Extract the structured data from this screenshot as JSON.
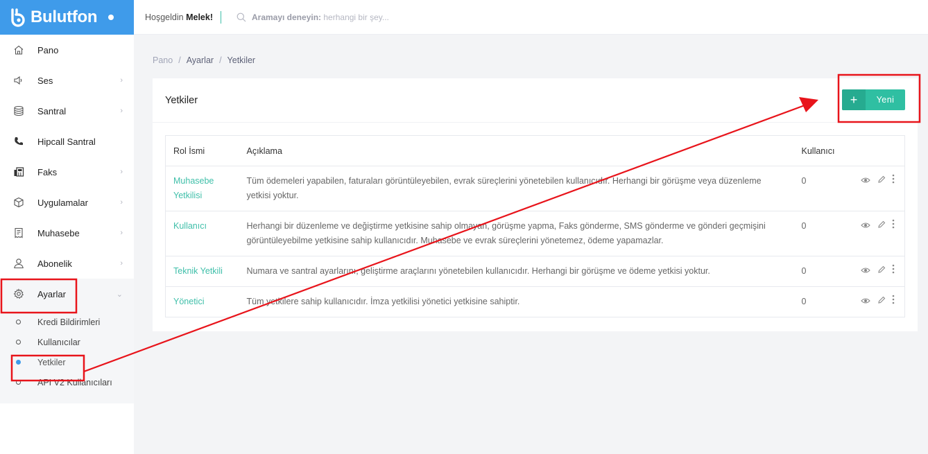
{
  "app": {
    "logo_text": "Bulutfon"
  },
  "header": {
    "greeting_prefix": "Hoşgeldin",
    "user_name": "Melek!",
    "search_label": "Aramayı deneyin:",
    "search_placeholder": "herhangi bir şey..."
  },
  "sidebar": {
    "items": [
      {
        "label": "Pano",
        "icon": "home-icon",
        "chevron": false
      },
      {
        "label": "Ses",
        "icon": "speaker-icon",
        "chevron": true
      },
      {
        "label": "Santral",
        "icon": "database-icon",
        "chevron": true
      },
      {
        "label": "Hipcall Santral",
        "icon": "phone-icon",
        "chevron": false
      },
      {
        "label": "Faks",
        "icon": "fax-icon",
        "chevron": true
      },
      {
        "label": "Uygulamalar",
        "icon": "box-icon",
        "chevron": true
      },
      {
        "label": "Muhasebe",
        "icon": "receipt-icon",
        "chevron": true
      },
      {
        "label": "Abonelik",
        "icon": "user-icon",
        "chevron": true
      },
      {
        "label": "Ayarlar",
        "icon": "gear-icon",
        "chevron": true,
        "expanded": true
      }
    ],
    "submenu": [
      {
        "label": "Kredi Bildirimleri",
        "active": false
      },
      {
        "label": "Kullanıcılar",
        "active": false
      },
      {
        "label": "Yetkiler",
        "active": true
      },
      {
        "label": "API V2 Kullanıcıları",
        "active": false
      }
    ]
  },
  "breadcrumb": [
    "Pano",
    "Ayarlar",
    "Yetkiler"
  ],
  "card": {
    "title": "Yetkiler",
    "new_button": "Yeni"
  },
  "table": {
    "headers": [
      "Rol İsmi",
      "Açıklama",
      "Kullanıcı"
    ],
    "rows": [
      {
        "role": "Muhasebe Yetkilisi",
        "description": "Tüm ödemeleri yapabilen, faturaları görüntüleyebilen, evrak süreçlerini yönetebilen kullanıcıdır. Herhangi bir görüşme veya düzenleme yetkisi yoktur.",
        "users": "0"
      },
      {
        "role": "Kullanıcı",
        "description": "Herhangi bir düzenleme ve değiştirme yetkisine sahip olmayan, görüşme yapma, Faks gönderme, SMS gönderme ve gönderi geçmişini görüntüleyebilme yetkisine sahip kullanıcıdır. Muhasebe ve evrak süreçlerini yönetemez, ödeme yapamazlar.",
        "users": "0"
      },
      {
        "role": "Teknik Yetkili",
        "description": "Numara ve santral ayarlarını, geliştirme araçlarını yönetebilen kullanıcıdır. Herhangi bir görüşme ve ödeme yetkisi yoktur.",
        "users": "0"
      },
      {
        "role": "Yönetici",
        "description": "Tüm yetkilere sahip kullanıcıdır. İmza yetkilisi yönetici yetkisine sahiptir.",
        "users": "0"
      }
    ]
  },
  "colors": {
    "brand_blue": "#3f9bea",
    "accent_teal": "#2fbfa2",
    "annotation_red": "#e8141b"
  }
}
